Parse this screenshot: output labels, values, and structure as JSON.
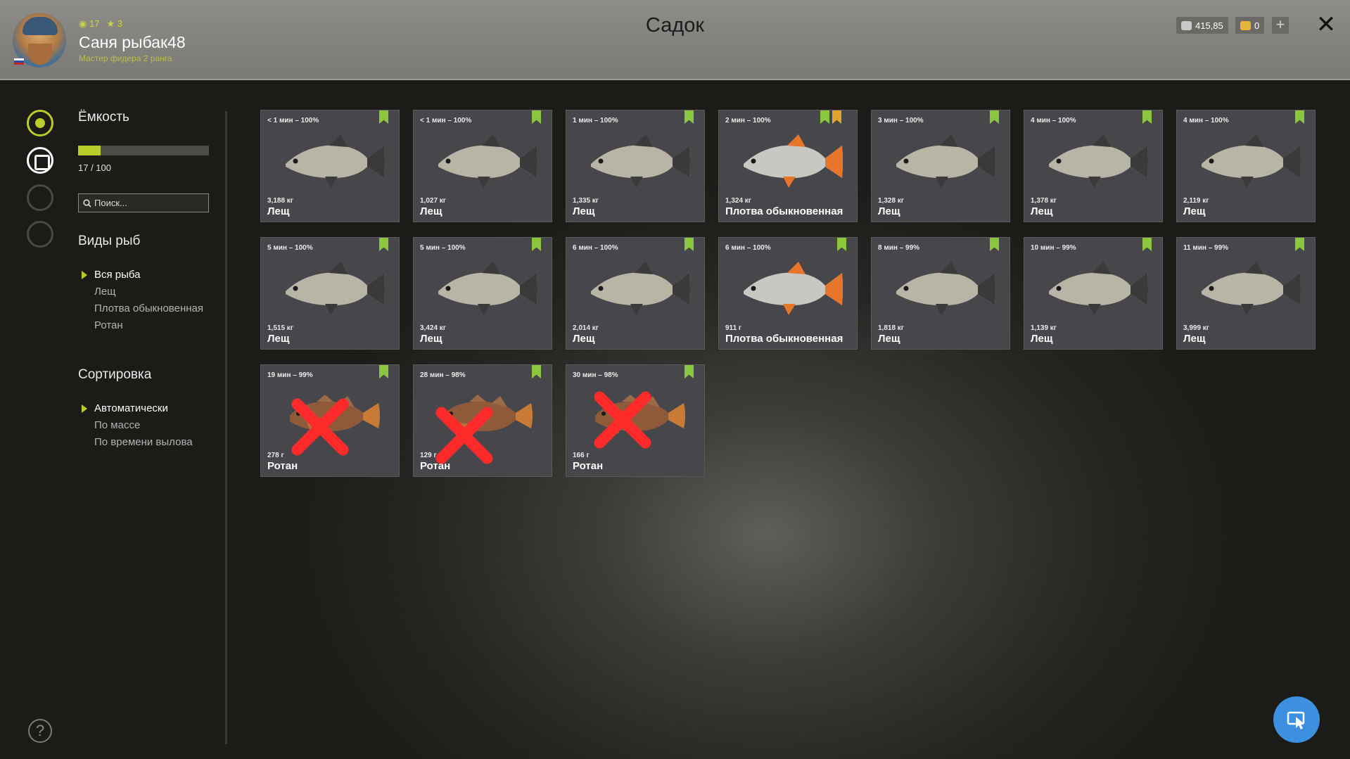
{
  "header": {
    "title": "Садок",
    "player": {
      "name": "Саня рыбак48",
      "rank": "Мастер фидера 2 ранга",
      "level": "17",
      "stars": "3"
    },
    "currency": {
      "silver": "415,85",
      "gold": "0"
    }
  },
  "sidebar": {
    "capacity_title": "Ёмкость",
    "capacity_text": "17 / 100",
    "capacity_fraction": 0.17,
    "search_placeholder": "Поиск...",
    "species_title": "Виды рыб",
    "species": [
      {
        "label": "Вся рыба",
        "active": true
      },
      {
        "label": "Лещ",
        "active": false
      },
      {
        "label": "Плотва обыкновенная",
        "active": false
      },
      {
        "label": "Ротан",
        "active": false
      }
    ],
    "sort_title": "Сортировка",
    "sort": [
      {
        "label": "Автоматически",
        "active": true
      },
      {
        "label": "По массе",
        "active": false
      },
      {
        "label": "По времени вылова",
        "active": false
      }
    ]
  },
  "fish": [
    {
      "time": "< 1 мин – 100%",
      "weight": "3,188 кг",
      "name": "Лещ",
      "kind": "bream",
      "crossed": false,
      "gold": false
    },
    {
      "time": "< 1 мин – 100%",
      "weight": "1,027 кг",
      "name": "Лещ",
      "kind": "bream",
      "crossed": false,
      "gold": false
    },
    {
      "time": "1 мин – 100%",
      "weight": "1,335 кг",
      "name": "Лещ",
      "kind": "bream",
      "crossed": false,
      "gold": false
    },
    {
      "time": "2 мин – 100%",
      "weight": "1,324 кг",
      "name": "Плотва обыкновенная",
      "kind": "roach",
      "crossed": false,
      "gold": true
    },
    {
      "time": "3 мин – 100%",
      "weight": "1,328 кг",
      "name": "Лещ",
      "kind": "bream",
      "crossed": false,
      "gold": false
    },
    {
      "time": "4 мин – 100%",
      "weight": "1,378 кг",
      "name": "Лещ",
      "kind": "bream",
      "crossed": false,
      "gold": false
    },
    {
      "time": "4 мин – 100%",
      "weight": "2,119 кг",
      "name": "Лещ",
      "kind": "bream",
      "crossed": false,
      "gold": false
    },
    {
      "time": "5 мин – 100%",
      "weight": "1,515 кг",
      "name": "Лещ",
      "kind": "bream",
      "crossed": false,
      "gold": false
    },
    {
      "time": "5 мин – 100%",
      "weight": "3,424 кг",
      "name": "Лещ",
      "kind": "bream",
      "crossed": false,
      "gold": false
    },
    {
      "time": "6 мин – 100%",
      "weight": "2,014 кг",
      "name": "Лещ",
      "kind": "bream",
      "crossed": false,
      "gold": false
    },
    {
      "time": "6 мин – 100%",
      "weight": "911 г",
      "name": "Плотва обыкновенная",
      "kind": "roach",
      "crossed": false,
      "gold": false
    },
    {
      "time": "8 мин – 99%",
      "weight": "1,818 кг",
      "name": "Лещ",
      "kind": "bream",
      "crossed": false,
      "gold": false
    },
    {
      "time": "10 мин – 99%",
      "weight": "1,139 кг",
      "name": "Лещ",
      "kind": "bream",
      "crossed": false,
      "gold": false
    },
    {
      "time": "11 мин – 99%",
      "weight": "3,999 кг",
      "name": "Лещ",
      "kind": "bream",
      "crossed": false,
      "gold": false
    },
    {
      "time": "19 мин – 99%",
      "weight": "278 г",
      "name": "Ротан",
      "kind": "rotan",
      "crossed": true,
      "gold": false
    },
    {
      "time": "28 мин – 98%",
      "weight": "129 г",
      "name": "Ротан",
      "kind": "rotan",
      "crossed": true,
      "gold": false
    },
    {
      "time": "30 мин – 98%",
      "weight": "166 г",
      "name": "Ротан",
      "kind": "rotan",
      "crossed": true,
      "gold": false
    }
  ]
}
